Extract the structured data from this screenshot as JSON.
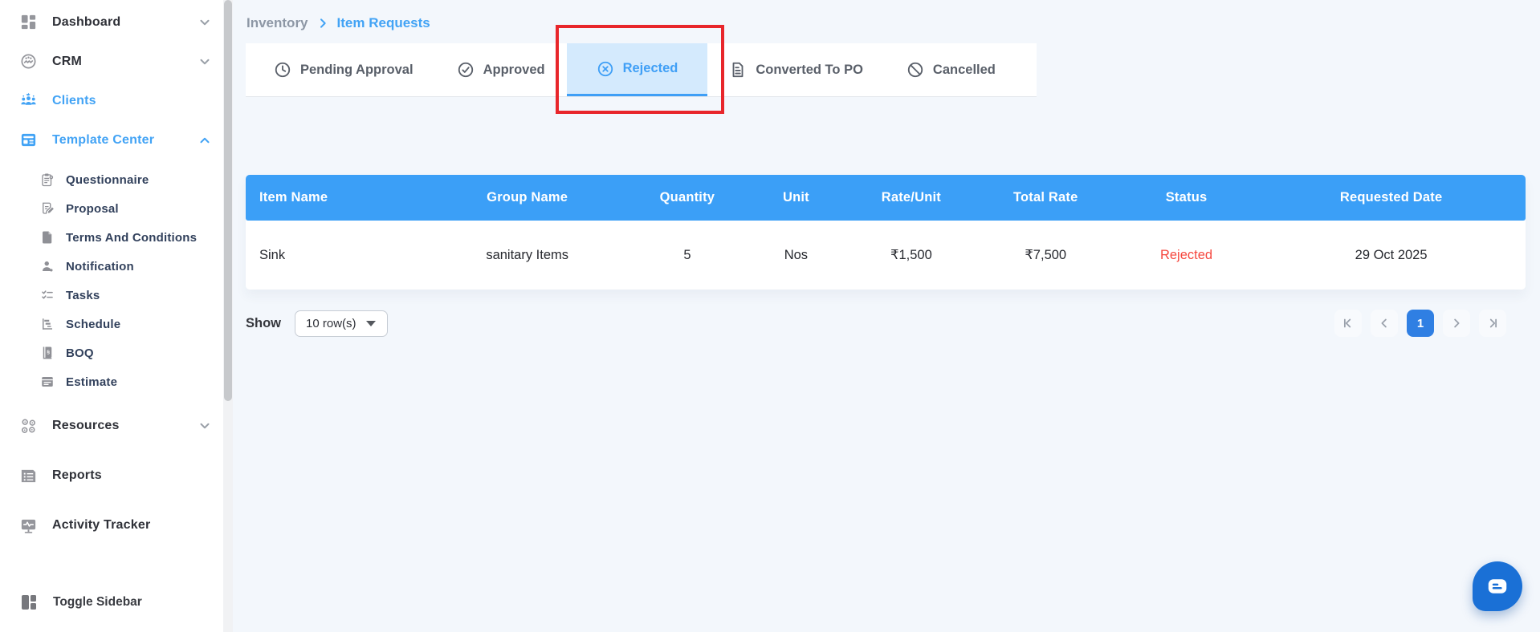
{
  "colors": {
    "accent_blue": "#42a3f5",
    "table_header_blue": "#3b9ff7",
    "active_tab_bg": "#d4eafd",
    "annotation_red": "#e8262b",
    "status_rejected_red": "#f5463d",
    "pagination_active_blue": "#2f7fe3",
    "chat_blue": "#1a70d6"
  },
  "sidebar": {
    "items": [
      {
        "label": "Dashboard",
        "icon": "dashboard-icon",
        "chevron": "down",
        "active": false
      },
      {
        "label": "CRM",
        "icon": "crm-icon",
        "chevron": "down",
        "active": false
      },
      {
        "label": "Clients",
        "icon": "clients-icon",
        "active": true
      },
      {
        "label": "Template Center",
        "icon": "template-center-icon",
        "chevron": "up",
        "active": true,
        "expanded": true
      },
      {
        "label": "Resources",
        "icon": "resources-icon",
        "chevron": "down",
        "active": false
      },
      {
        "label": "Reports",
        "icon": "reports-icon",
        "active": false
      },
      {
        "label": "Activity Tracker",
        "icon": "activity-tracker-icon",
        "active": false
      }
    ],
    "subitems": [
      {
        "label": "Questionnaire",
        "icon": "questionnaire-icon"
      },
      {
        "label": "Proposal",
        "icon": "proposal-icon"
      },
      {
        "label": "Terms And Conditions",
        "icon": "terms-icon"
      },
      {
        "label": "Notification",
        "icon": "notification-icon"
      },
      {
        "label": "Tasks",
        "icon": "tasks-icon"
      },
      {
        "label": "Schedule",
        "icon": "schedule-icon"
      },
      {
        "label": "BOQ",
        "icon": "boq-icon"
      },
      {
        "label": "Estimate",
        "icon": "estimate-icon"
      }
    ],
    "toggle_label": "Toggle Sidebar"
  },
  "breadcrumb": {
    "parent": "Inventory",
    "current": "Item Requests"
  },
  "tabs": [
    {
      "label": "Pending Approval",
      "icon": "clock-icon",
      "active": false
    },
    {
      "label": "Approved",
      "icon": "check-circle-icon",
      "active": false
    },
    {
      "label": "Rejected",
      "icon": "x-circle-icon",
      "active": true,
      "annotated": true
    },
    {
      "label": "Converted To PO",
      "icon": "file-icon",
      "active": false
    },
    {
      "label": "Cancelled",
      "icon": "slash-circle-icon",
      "active": false
    }
  ],
  "table": {
    "headers": [
      "Item Name",
      "Group Name",
      "Quantity",
      "Unit",
      "Rate/Unit",
      "Total Rate",
      "Status",
      "Requested Date"
    ],
    "rows": [
      {
        "item_name": "Sink",
        "group_name": "sanitary Items",
        "quantity": "5",
        "unit": "Nos",
        "rate_unit": "₹1,500",
        "total_rate": "₹7,500",
        "status": "Rejected",
        "requested_date": "29 Oct 2025"
      }
    ]
  },
  "controls": {
    "show_label": "Show",
    "rows_per_page": "10 row(s)"
  },
  "pagination": {
    "current_page": "1"
  }
}
